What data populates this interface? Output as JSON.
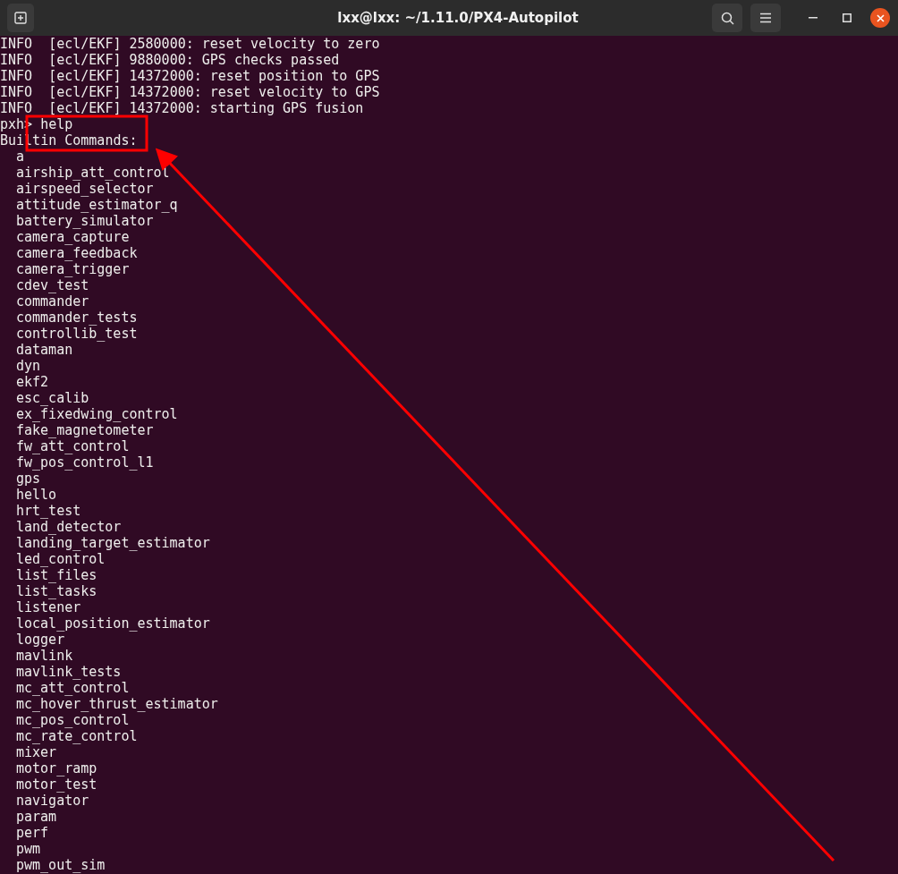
{
  "window": {
    "title": "lxx@lxx: ~/1.11.0/PX4-Autopilot"
  },
  "terminal": {
    "log_lines": [
      "INFO  [ecl/EKF] 2580000: reset velocity to zero",
      "INFO  [ecl/EKF] 9880000: GPS checks passed",
      "INFO  [ecl/EKF] 14372000: reset position to GPS",
      "INFO  [ecl/EKF] 14372000: reset velocity to GPS",
      "INFO  [ecl/EKF] 14372000: starting GPS fusion"
    ],
    "prompt": "pxh>",
    "command": "help",
    "heading": "Builtin Commands:",
    "commands": [
      "a",
      "airship_att_control",
      "airspeed_selector",
      "attitude_estimator_q",
      "battery_simulator",
      "camera_capture",
      "camera_feedback",
      "camera_trigger",
      "cdev_test",
      "commander",
      "commander_tests",
      "controllib_test",
      "dataman",
      "dyn",
      "ekf2",
      "esc_calib",
      "ex_fixedwing_control",
      "fake_magnetometer",
      "fw_att_control",
      "fw_pos_control_l1",
      "gps",
      "hello",
      "hrt_test",
      "land_detector",
      "landing_target_estimator",
      "led_control",
      "list_files",
      "list_tasks",
      "listener",
      "local_position_estimator",
      "logger",
      "mavlink",
      "mavlink_tests",
      "mc_att_control",
      "mc_hover_thrust_estimator",
      "mc_pos_control",
      "mc_rate_control",
      "mixer",
      "motor_ramp",
      "motor_test",
      "navigator",
      "param",
      "perf",
      "pwm",
      "pwm_out_sim"
    ]
  }
}
